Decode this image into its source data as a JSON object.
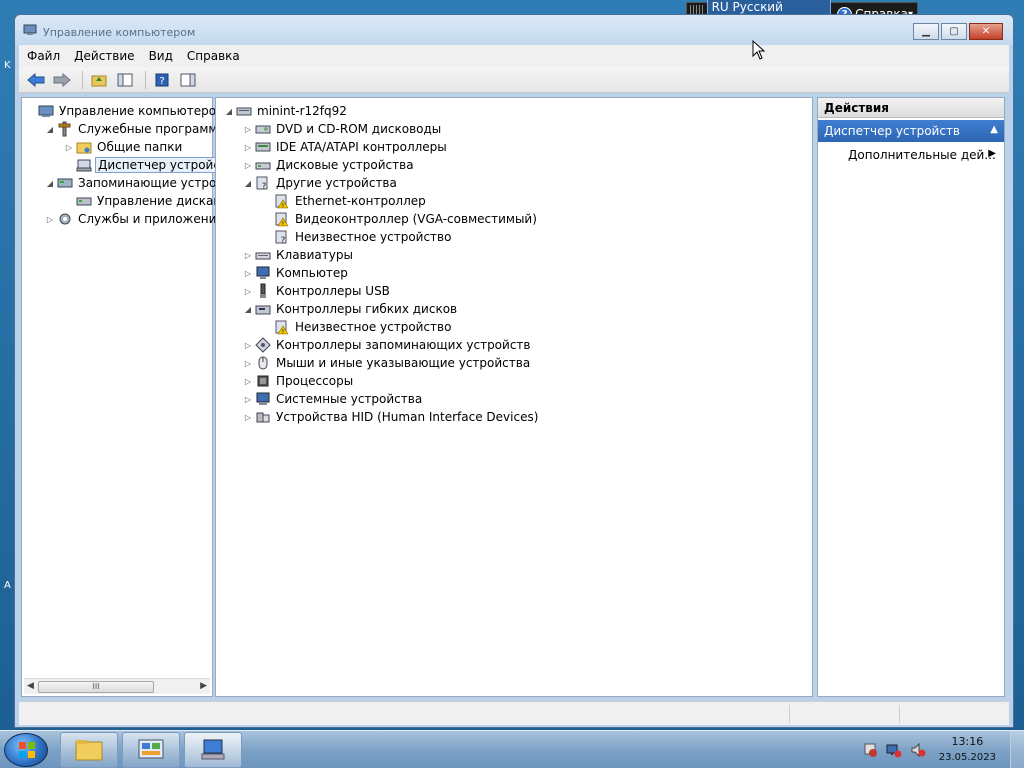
{
  "window": {
    "title": "Управление компьютером",
    "menu": [
      "Файл",
      "Действие",
      "Вид",
      "Справка"
    ]
  },
  "left_tree": [
    {
      "label": "Управление компьютером (л",
      "icon": "computer-management-icon",
      "level": 0,
      "expander": "none"
    },
    {
      "label": "Служебные программы",
      "icon": "tools-icon",
      "level": 1,
      "expander": "expanded"
    },
    {
      "label": "Общие папки",
      "icon": "shared-folders-icon",
      "level": 2,
      "expander": "collapsed"
    },
    {
      "label": "Диспетчер устройств",
      "icon": "device-manager-icon",
      "level": 2,
      "expander": "none",
      "selected": true
    },
    {
      "label": "Запоминающие устройст",
      "icon": "storage-icon",
      "level": 1,
      "expander": "expanded"
    },
    {
      "label": "Управление дисками",
      "icon": "disk-management-icon",
      "level": 2,
      "expander": "none"
    },
    {
      "label": "Службы и приложения",
      "icon": "services-icon",
      "level": 1,
      "expander": "collapsed"
    }
  ],
  "left_scroll": {
    "grip": "III"
  },
  "device_tree": {
    "root": "minint-r12fq92",
    "items": [
      {
        "label": "DVD и CD-ROM дисководы",
        "icon": "dvd-drive-icon",
        "level": 1,
        "expander": "collapsed"
      },
      {
        "label": "IDE ATA/ATAPI контроллеры",
        "icon": "ide-controller-icon",
        "level": 1,
        "expander": "collapsed"
      },
      {
        "label": "Дисковые устройства",
        "icon": "disk-drive-icon",
        "level": 1,
        "expander": "collapsed"
      },
      {
        "label": "Другие устройства",
        "icon": "unknown-device-icon",
        "level": 1,
        "expander": "expanded"
      },
      {
        "label": "Ethernet-контроллер",
        "icon": "warning-device-icon",
        "level": 2,
        "expander": "none"
      },
      {
        "label": "Видеоконтроллер (VGA-совместимый)",
        "icon": "warning-device-icon",
        "level": 2,
        "expander": "none"
      },
      {
        "label": "Неизвестное устройство",
        "icon": "unknown-device-icon",
        "level": 2,
        "expander": "none"
      },
      {
        "label": "Клавиатуры",
        "icon": "keyboard-icon",
        "level": 1,
        "expander": "collapsed"
      },
      {
        "label": "Компьютер",
        "icon": "computer-icon",
        "level": 1,
        "expander": "collapsed"
      },
      {
        "label": "Контроллеры USB",
        "icon": "usb-icon",
        "level": 1,
        "expander": "collapsed"
      },
      {
        "label": "Контроллеры гибких дисков",
        "icon": "floppy-controller-icon",
        "level": 1,
        "expander": "expanded"
      },
      {
        "label": "Неизвестное устройство",
        "icon": "warning-device-icon",
        "level": 2,
        "expander": "none"
      },
      {
        "label": "Контроллеры запоминающих устройств",
        "icon": "storage-controller-icon",
        "level": 1,
        "expander": "collapsed"
      },
      {
        "label": "Мыши и иные указывающие устройства",
        "icon": "mouse-icon",
        "level": 1,
        "expander": "collapsed"
      },
      {
        "label": "Процессоры",
        "icon": "processor-icon",
        "level": 1,
        "expander": "collapsed"
      },
      {
        "label": "Системные устройства",
        "icon": "system-device-icon",
        "level": 1,
        "expander": "collapsed"
      },
      {
        "label": "Устройства HID (Human Interface Devices)",
        "icon": "hid-icon",
        "level": 1,
        "expander": "collapsed"
      }
    ]
  },
  "actions": {
    "header": "Действия",
    "section": "Диспетчер устройств",
    "item": "Дополнительные дей..."
  },
  "langbar": {
    "language": "RU Русский (Россия)",
    "help": "Справка",
    "help_glyph": "?"
  },
  "taskbar": {
    "time": "13:16",
    "date": "23.05.2023"
  },
  "colors": {
    "selection_border": "#7da2ce",
    "actions_section": "#2c66b5",
    "warning": "#f2c200"
  }
}
